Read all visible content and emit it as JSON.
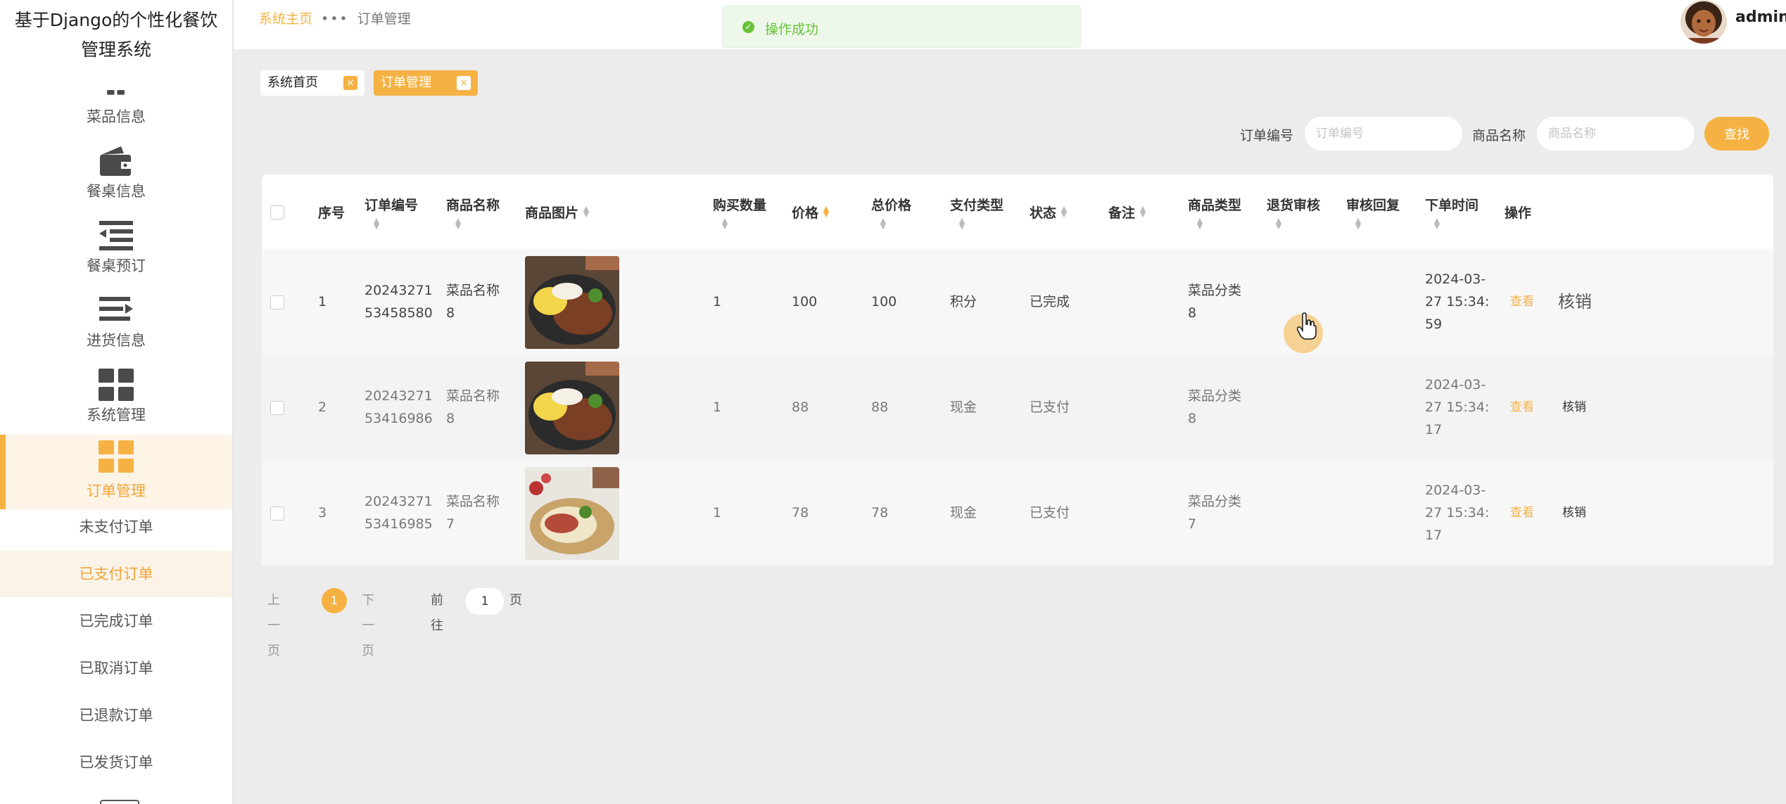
{
  "app": {
    "title_line1": "基于Django的个性化餐饮",
    "title_line2": "管理系统"
  },
  "sidebar": {
    "menu": [
      {
        "label": "菜品信息",
        "icon": "food-icon"
      },
      {
        "label": "餐桌信息",
        "icon": "wallet-icon"
      },
      {
        "label": "餐桌预订",
        "icon": "list-indent-icon"
      },
      {
        "label": "进货信息",
        "icon": "list-arrow-icon"
      },
      {
        "label": "系统管理",
        "icon": "grid-icon"
      },
      {
        "label": "订单管理",
        "icon": "grid-icon",
        "active": true
      }
    ],
    "submenu": [
      {
        "label": "未支付订单"
      },
      {
        "label": "已支付订单",
        "active": true
      },
      {
        "label": "已完成订单"
      },
      {
        "label": "已取消订单"
      },
      {
        "label": "已退款订单"
      },
      {
        "label": "已发货订单"
      }
    ]
  },
  "topbar": {
    "breadcrumb": {
      "home": "系统主页",
      "current": "订单管理"
    },
    "toast": "操作成功",
    "username": "admin"
  },
  "tabs": [
    {
      "label": "系统首页",
      "close": "×"
    },
    {
      "label": "订单管理",
      "close": "×"
    }
  ],
  "search": {
    "order_no_label": "订单编号",
    "order_no_placeholder": "订单编号",
    "product_name_label": "商品名称",
    "product_name_placeholder": "商品名称",
    "button": "查找"
  },
  "table": {
    "headers": [
      "序号",
      "订单编号",
      "商品名称",
      "商品图片",
      "购买数量",
      "价格",
      "总价格",
      "支付类型",
      "状态",
      "备注",
      "商品类型",
      "退货审核",
      "审核回复",
      "下单时间",
      "操作"
    ],
    "rows": [
      {
        "index": "1",
        "order_no_a": "20243271",
        "order_no_b": "53458580",
        "name_a": "菜品名称",
        "name_b": "8",
        "qty": "1",
        "price": "100",
        "total": "100",
        "pay_type": "积分",
        "status": "已完成",
        "note": "",
        "type_a": "菜品分类",
        "type_b": "8",
        "return_review": "",
        "review_reply": "",
        "time_a": "2024-03-",
        "time_b": "27 15:34:",
        "time_c": "59",
        "view": "查看",
        "verify": "核销"
      },
      {
        "index": "2",
        "order_no_a": "20243271",
        "order_no_b": "53416986",
        "name_a": "菜品名称",
        "name_b": "8",
        "qty": "1",
        "price": "88",
        "total": "88",
        "pay_type": "现金",
        "status": "已支付",
        "note": "",
        "type_a": "菜品分类",
        "type_b": "8",
        "return_review": "",
        "review_reply": "",
        "time_a": "2024-03-",
        "time_b": "27 15:34:",
        "time_c": "17",
        "view": "查看",
        "verify": "核销"
      },
      {
        "index": "3",
        "order_no_a": "20243271",
        "order_no_b": "53416985",
        "name_a": "菜品名称",
        "name_b": "7",
        "qty": "1",
        "price": "78",
        "total": "78",
        "pay_type": "现金",
        "status": "已支付",
        "note": "",
        "type_a": "菜品分类",
        "type_b": "7",
        "return_review": "",
        "review_reply": "",
        "time_a": "2024-03-",
        "time_b": "27 15:34:",
        "time_c": "17",
        "view": "查看",
        "verify": "核销"
      }
    ]
  },
  "pagination": {
    "prev": "上一页",
    "current": "1",
    "next": "下一页",
    "goto_label": "前往",
    "goto_value": "1",
    "page_label": "页"
  },
  "colors": {
    "accent": "#f5b243",
    "success": "#67c23a",
    "sidebar_active_bg": "#fdf4e6"
  }
}
